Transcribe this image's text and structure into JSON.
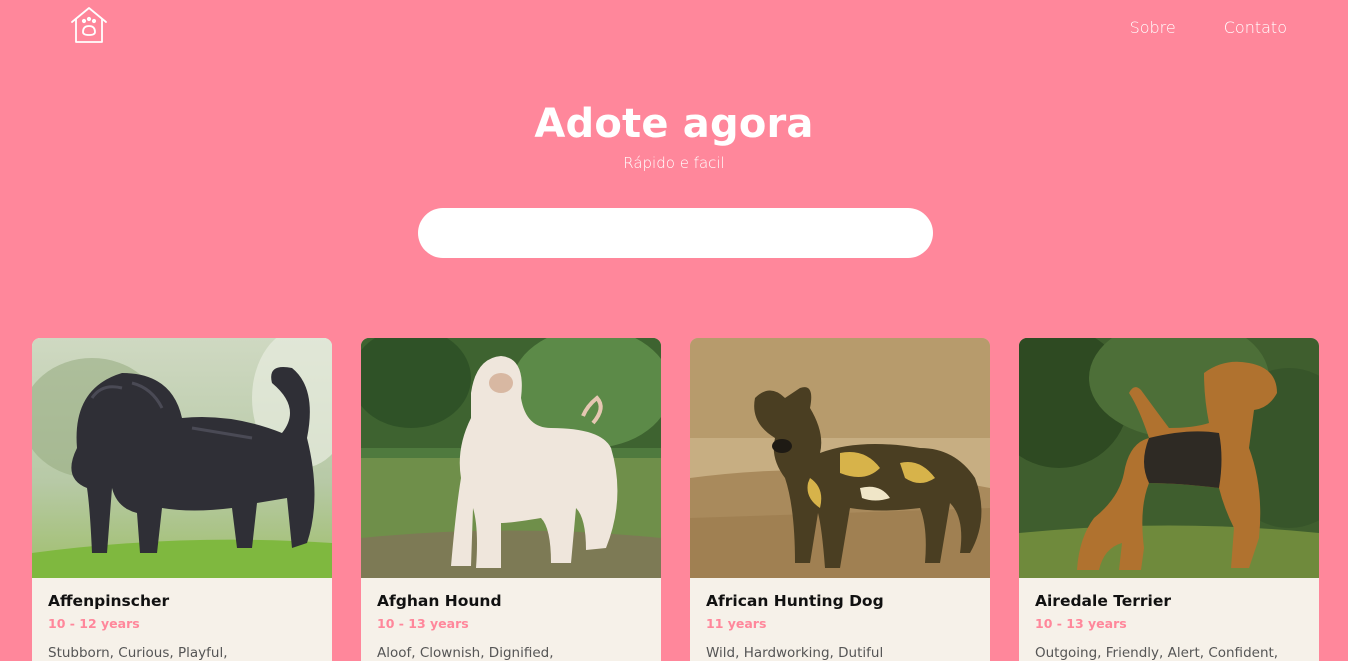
{
  "nav": {
    "logo_icon": "dog-house-icon",
    "links": [
      "Sobre",
      "Contato"
    ]
  },
  "hero": {
    "title": "Adote agora",
    "subtitle": "Rápido e facil"
  },
  "search": {
    "value": "",
    "placeholder": ""
  },
  "colors": {
    "background": "#FF879B",
    "card_background": "#F6F1E9",
    "accent": "#FF879B"
  },
  "cards": [
    {
      "name": "Affenpinscher",
      "years": "10 - 12 years",
      "temperament": "Stubborn, Curious, Playful,"
    },
    {
      "name": "Afghan Hound",
      "years": "10 - 13 years",
      "temperament": "Aloof, Clownish, Dignified,"
    },
    {
      "name": "African Hunting Dog",
      "years": "11 years",
      "temperament": "Wild, Hardworking, Dutiful"
    },
    {
      "name": "Airedale Terrier",
      "years": "10 - 13 years",
      "temperament": "Outgoing, Friendly, Alert, Confident,"
    }
  ]
}
